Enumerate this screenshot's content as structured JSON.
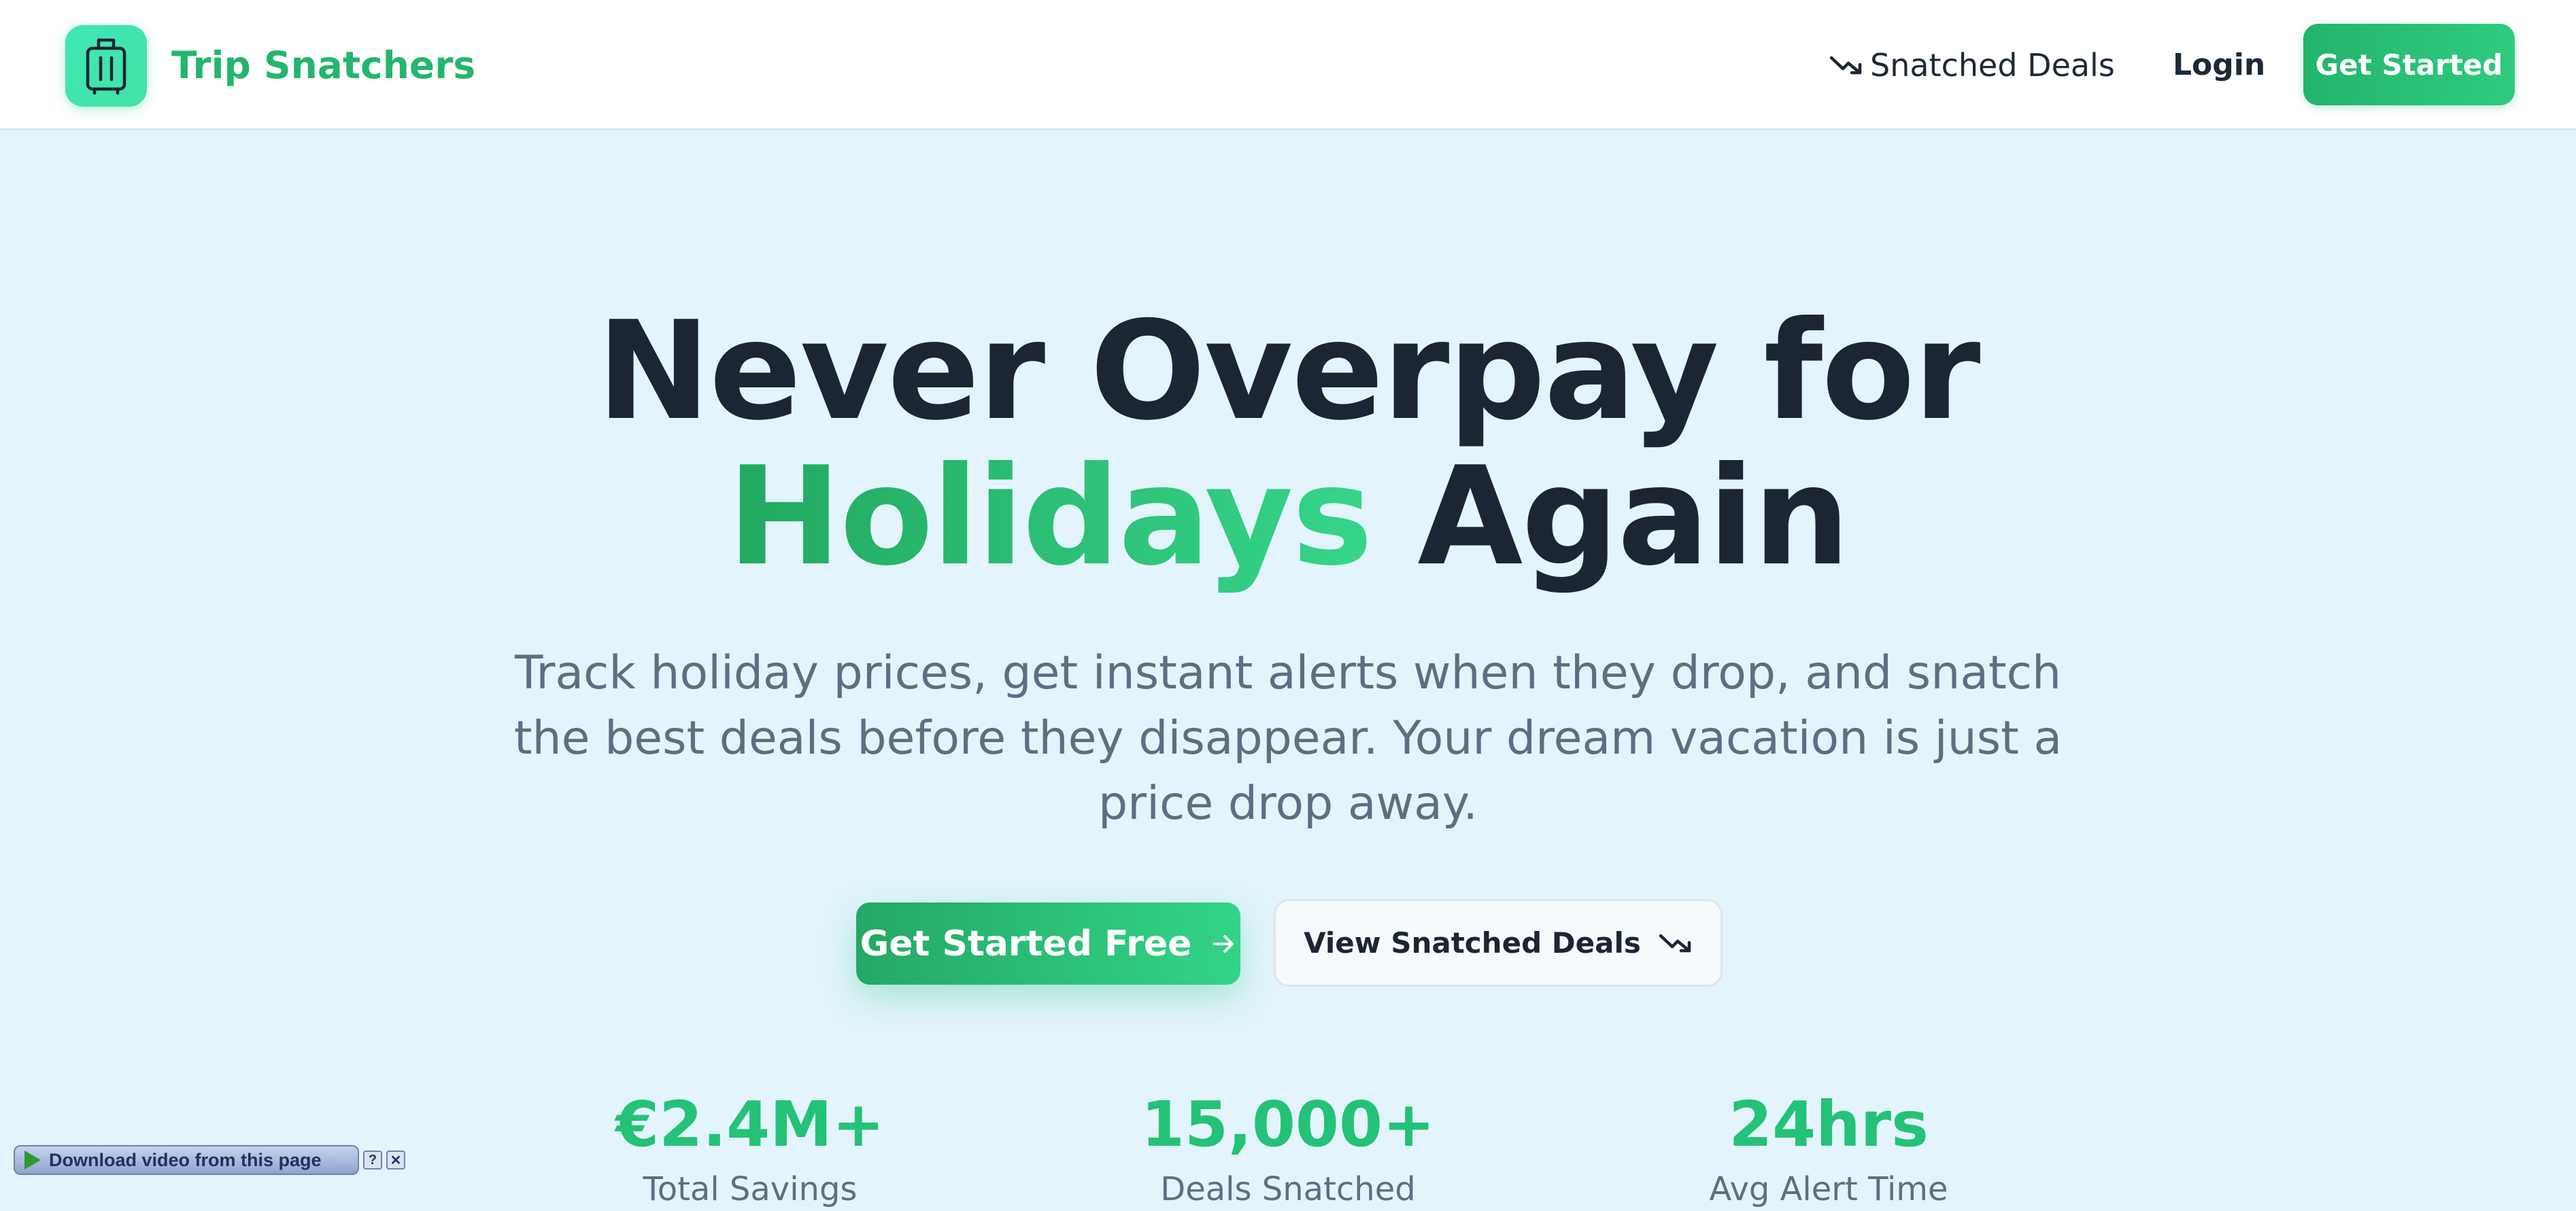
{
  "header": {
    "brand": "Trip Snatchers",
    "logo_icon": "suitcase-icon",
    "nav_deals_label": "Snatched Deals",
    "nav_deals_icon": "trending-down-icon",
    "login_label": "Login",
    "cta_label": "Get Started"
  },
  "hero": {
    "title_line1": "Never Overpay for",
    "title_accent": "Holidays",
    "title_rest": " Again",
    "subtitle": "Track holiday prices, get instant alerts when they drop, and snatch the best deals before they disappear. Your dream vacation is just a price drop away.",
    "primary_cta": "Get Started Free",
    "primary_cta_icon": "arrow-right-icon",
    "secondary_cta": "View Snatched Deals",
    "secondary_cta_icon": "trending-down-icon"
  },
  "stats": [
    {
      "value": "€2.4M+",
      "label": "Total Savings"
    },
    {
      "value": "15,000+",
      "label": "Deals Snatched"
    },
    {
      "value": "24hrs",
      "label": "Avg Alert Time"
    }
  ],
  "download_bar": {
    "label": "Download video from this page",
    "help": "?",
    "close": "✕"
  },
  "colors": {
    "accent": "#25b56d",
    "background": "#e3f4fc",
    "heading": "#1c2533",
    "muted": "#5c6f82"
  }
}
